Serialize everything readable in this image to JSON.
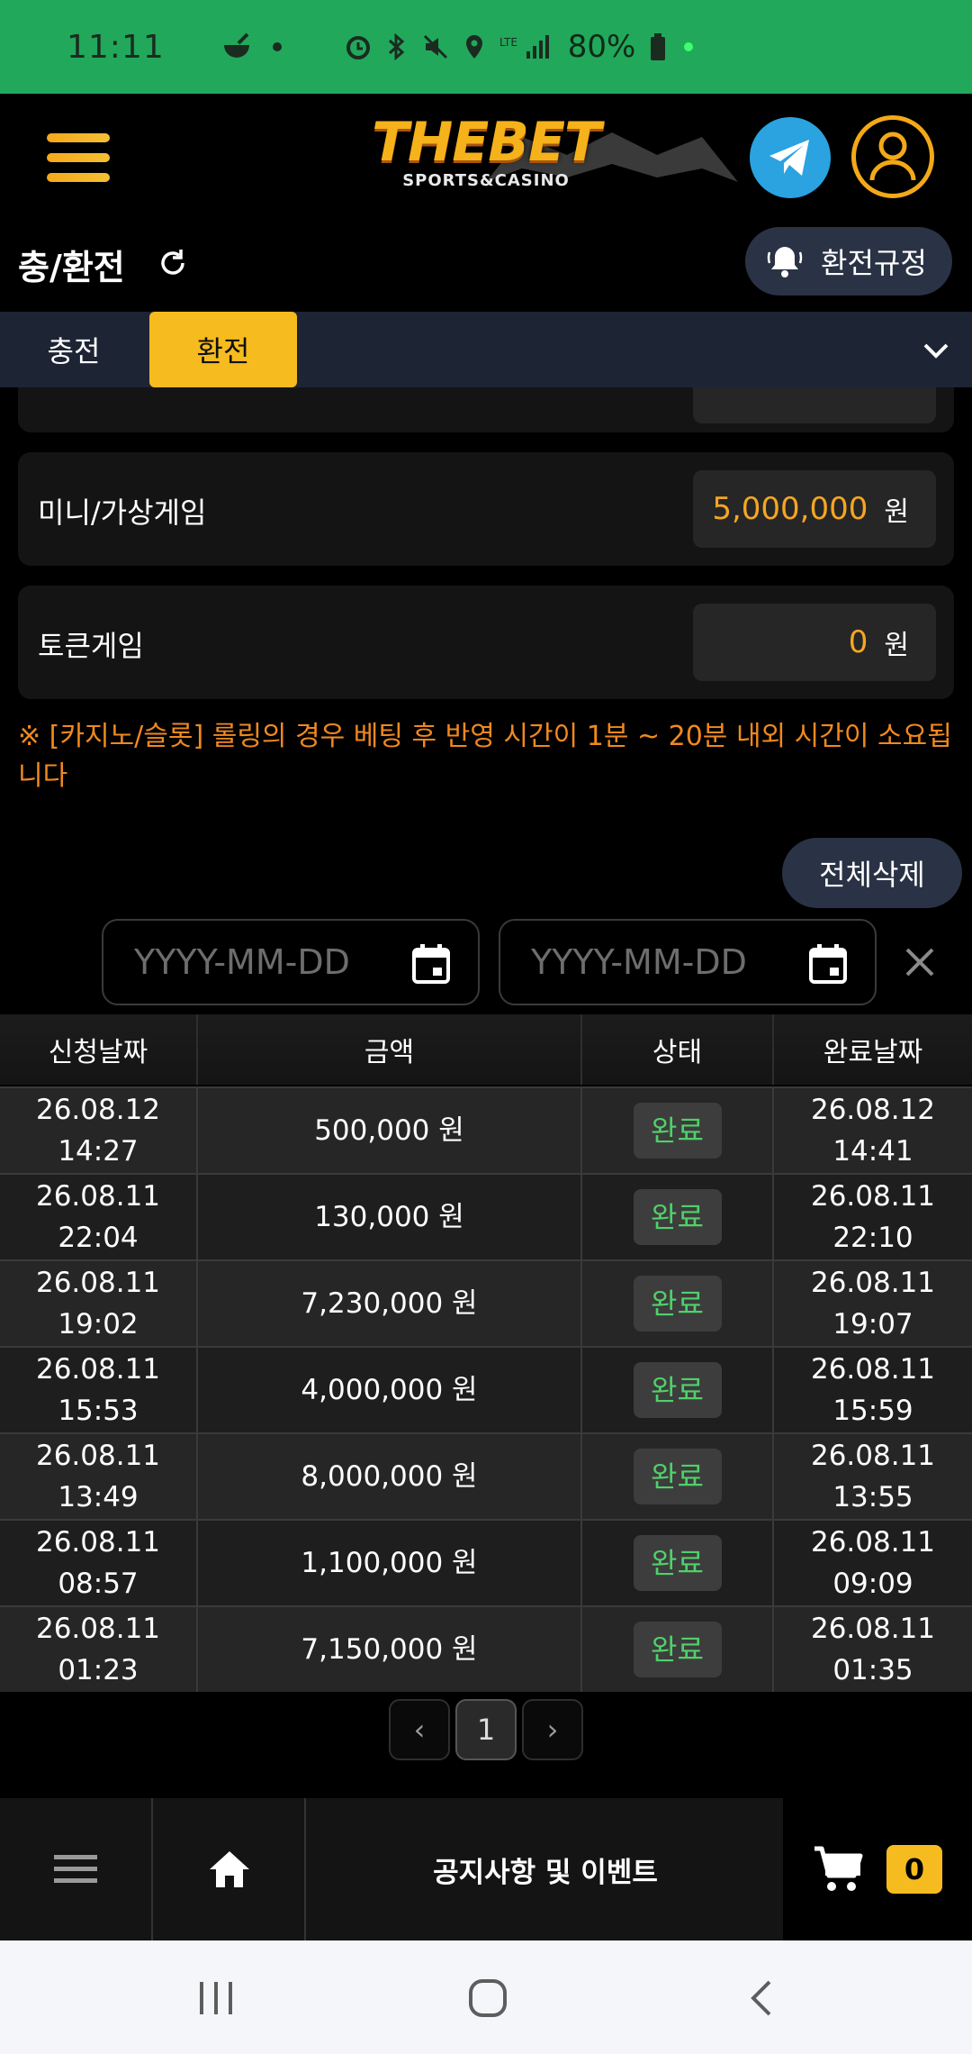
{
  "status_bar": {
    "time": "11:11",
    "battery": "80%"
  },
  "header": {
    "logo_text": "THEBET",
    "logo_subtext": "SPORTS&CASINO"
  },
  "title_row": {
    "title": "충/환전",
    "rules_label": "환전규정"
  },
  "tabs": [
    {
      "label": "충전",
      "active": false
    },
    {
      "label": "환전",
      "active": true
    }
  ],
  "balances": [
    {
      "label": "미니/가상게임",
      "value": "5,000,000",
      "unit": "원"
    },
    {
      "label": "토큰게임",
      "value": "0",
      "unit": "원"
    }
  ],
  "notice": "※ [카지노/슬롯] 롤링의 경우 베팅 후 반영 시간이 1분 ~ 20분 내외 시간이 소요됩니다",
  "delete_all_label": "전체삭제",
  "date_filter": {
    "from_placeholder": "YYYY-MM-DD",
    "to_placeholder": "YYYY-MM-DD"
  },
  "table": {
    "headers": [
      "신청날짜",
      "금액",
      "상태",
      "완료날짜"
    ],
    "rows": [
      {
        "requested": "26.08.12\n14:27",
        "amount": "500,000 원",
        "status": "완료",
        "completed": "26.08.12\n14:41"
      },
      {
        "requested": "26.08.11\n22:04",
        "amount": "130,000 원",
        "status": "완료",
        "completed": "26.08.11\n22:10"
      },
      {
        "requested": "26.08.11\n19:02",
        "amount": "7,230,000 원",
        "status": "완료",
        "completed": "26.08.11\n19:07"
      },
      {
        "requested": "26.08.11\n15:53",
        "amount": "4,000,000 원",
        "status": "완료",
        "completed": "26.08.11\n15:59"
      },
      {
        "requested": "26.08.11\n13:49",
        "amount": "8,000,000 원",
        "status": "완료",
        "completed": "26.08.11\n13:55"
      },
      {
        "requested": "26.08.11\n08:57",
        "amount": "1,100,000 원",
        "status": "완료",
        "completed": "26.08.11\n09:09"
      },
      {
        "requested": "26.08.11\n01:23",
        "amount": "7,150,000 원",
        "status": "완료",
        "completed": "26.08.11\n01:35"
      }
    ]
  },
  "pagination": {
    "prev": "‹",
    "current": "1",
    "next": "›"
  },
  "bottom_bar": {
    "notice_label": "공지사항 및 이벤트",
    "cart_count": "0"
  },
  "colors": {
    "status_bar": "#21a85b",
    "accent_yellow": "#f6bb1e",
    "value_orange": "#f5a623",
    "status_done_green": "#4fd16a",
    "pill_bg": "#2a3345"
  },
  "icons": [
    "menu-icon",
    "telegram-icon",
    "user-icon",
    "refresh-icon",
    "bell-icon",
    "chevron-down-icon",
    "calendar-icon",
    "close-icon",
    "home-icon",
    "cart-icon",
    "recents-icon",
    "home-circle-icon",
    "back-icon"
  ]
}
